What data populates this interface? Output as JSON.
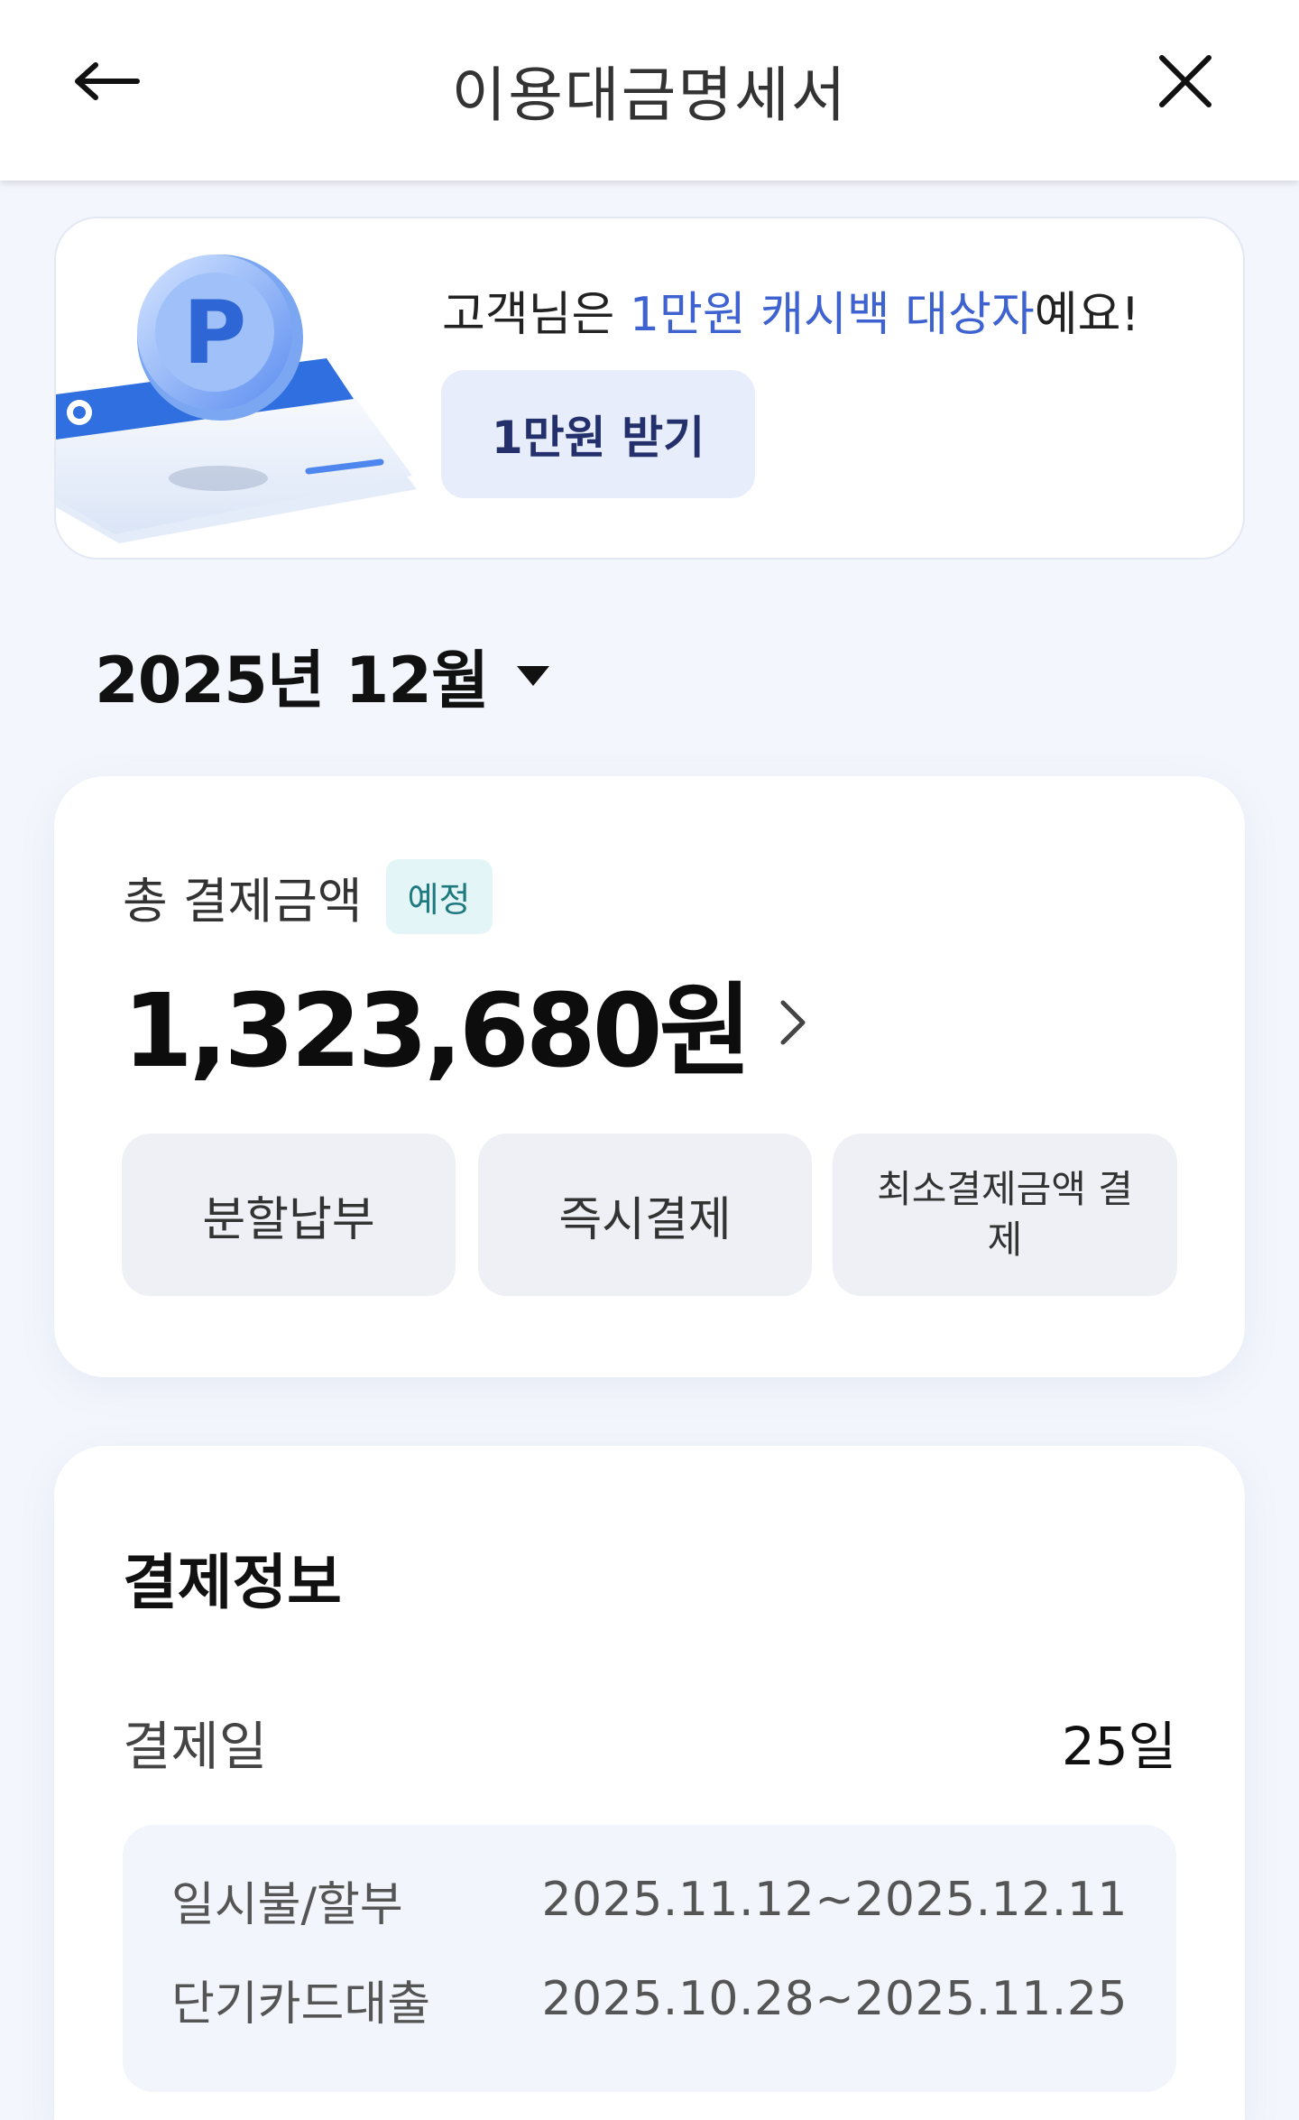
{
  "header": {
    "title": "이용대금명세서",
    "back_icon": "arrow-left-icon",
    "close_icon": "close-icon"
  },
  "promo": {
    "text_prefix": "고객님은 ",
    "text_highlight": "1만원 캐시백 대상자",
    "text_suffix": "예요!",
    "button_label": "1만원 받기",
    "accent_color": "#3e63d1",
    "coin_letter": "P"
  },
  "month_selector": {
    "label": "2025년 12월"
  },
  "total": {
    "label": "총 결제금액",
    "badge": "예정",
    "amount": "1,323,680원",
    "actions": [
      "분할납부",
      "즉시결제",
      "최소결제금액 결제"
    ]
  },
  "payment_info": {
    "title": "결제정보",
    "pay_day_label": "결제일",
    "pay_day_value": "25일",
    "periods": [
      {
        "label": "일시불/할부",
        "range": "2025.11.12~2025.12.11"
      },
      {
        "label": "단기카드대출",
        "range": "2025.10.28~2025.11.25"
      }
    ]
  }
}
